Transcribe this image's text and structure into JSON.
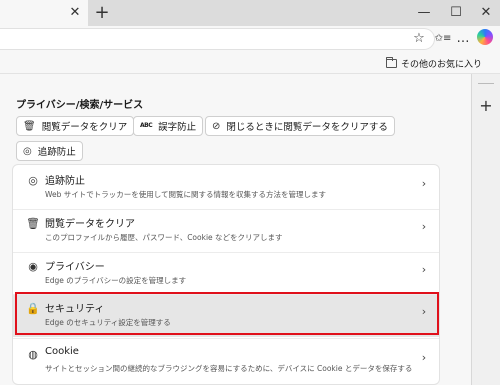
{
  "tabbar": {
    "close_icon": "✕",
    "new_tab_icon": "+",
    "minimize_icon": "—",
    "maximize_icon": "☐",
    "window_close_icon": "✕"
  },
  "toolbar": {
    "favorite_icon": "☆",
    "favorites_icon": "✩≡",
    "more_icon": "…"
  },
  "favorites_bar": {
    "other_favorites": "その他のお気に入り"
  },
  "section": {
    "title": "プライバシー/検索/サービス"
  },
  "chips": [
    {
      "icon": "🗑",
      "label": "閲覧データをクリア"
    },
    {
      "icon": "ABC",
      "label": "誤字防止"
    },
    {
      "icon": "⊘",
      "label": "閉じるときに閲覧データをクリアする"
    },
    {
      "icon": "◎",
      "label": "追跡防止"
    }
  ],
  "settings": [
    {
      "icon": "◎",
      "title": "追跡防止",
      "description": "Web サイトでトラッカーを使用して閲覧に関する情報を収集する方法を管理します"
    },
    {
      "icon": "🗑",
      "title": "閲覧データをクリア",
      "description": "このプロファイルから履歴、パスワード、Cookie などをクリアします"
    },
    {
      "icon": "◉",
      "title": "プライバシー",
      "description": "Edge のプライバシーの設定を管理します"
    },
    {
      "icon": "🔒",
      "title": "セキュリティ",
      "description": "Edge のセキュリティ設定を管理する"
    },
    {
      "icon": "◍",
      "title": "Cookie",
      "description": "サイトとセッション間の継続的なブラウジングを容易にするために、デバイスに Cookie とデータを保存する"
    }
  ],
  "chevron_icon": "›",
  "side_panel": {
    "add_icon": "+"
  }
}
